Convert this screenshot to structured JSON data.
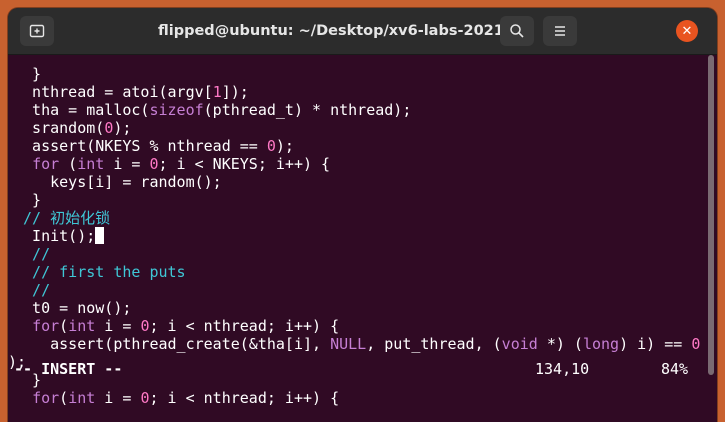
{
  "window": {
    "title": "flipped@ubuntu: ~/Desktop/xv6-labs-2021",
    "buttons": {
      "new_tab_icon": "new-tab-icon",
      "search_icon": "search-icon",
      "menu_icon": "menu-icon",
      "close_icon": "close-icon"
    }
  },
  "editor": {
    "lines": [
      "  }",
      "  nthread = atoi(argv[1]);",
      "  tha = malloc(sizeof(pthread_t) * nthread);",
      "  srandom(0);",
      "  assert(NKEYS % nthread == 0);",
      "  for (int i = 0; i < NKEYS; i++) {",
      "    keys[i] = random();",
      "  }",
      " // 初始化锁",
      "  Init();",
      "  //",
      "  // first the puts",
      "  //",
      "  t0 = now();",
      "  for(int i = 0; i < nthread; i++) {",
      "    assert(pthread_create(&tha[i], NULL, put_thread, (void *) (long) i) == 0",
      ");",
      "  }",
      "  for(int i = 0; i < nthread; i++) {"
    ]
  },
  "status": {
    "mode": "-- INSERT --",
    "position": "134,10",
    "percent": "84%"
  },
  "colors": {
    "background": "#300a24",
    "keyword": "#c67fd4",
    "comment": "#3fc7d6",
    "number": "#ff79c6",
    "accent_close": "#e95420"
  }
}
